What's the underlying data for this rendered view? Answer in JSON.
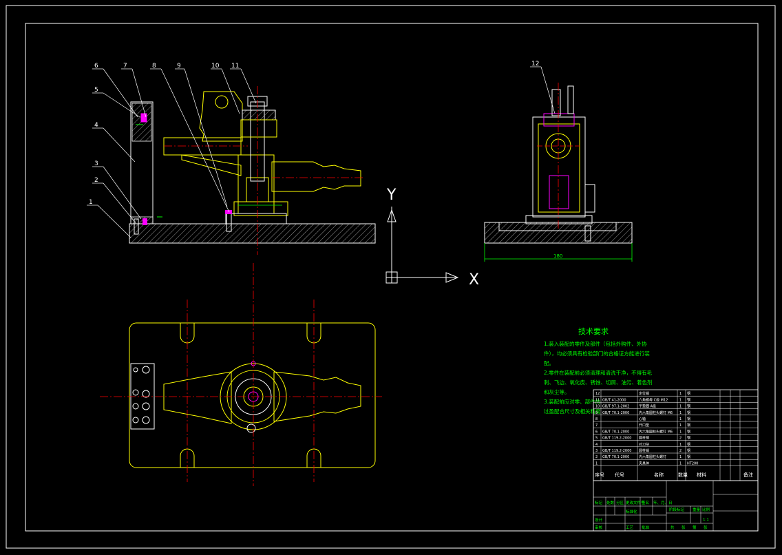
{
  "drawing": {
    "colors": {
      "background": "#000000",
      "frame": "#ffffff",
      "part_outline": "#ffff00",
      "center_line": "#ff0000",
      "hatch": "#cccccc",
      "dimension": "#00ff00",
      "highlight": "#ff00ff",
      "label_text": "#ffffff",
      "notes_text": "#00ff00"
    },
    "balloons": [
      "6",
      "7",
      "8",
      "9",
      "10",
      "11",
      "5",
      "4",
      "3",
      "2",
      "1",
      "12"
    ],
    "ucs": {
      "y_label": "Y",
      "x_label": "X"
    },
    "technical_requirements": {
      "title": "技术要求",
      "lines": [
        "1.装入装配的零件及部件（包括外购件、外协",
        "件），均必须具有检验部门的合格证方能进行装",
        "配。",
        "2.零件在装配前必须清理和清洗干净，不得有毛",
        "刺、飞边、氧化皮、锈蚀、切屑、油污、着色剂",
        "和灰尘等。",
        "3.装配前应对零、部件的",
        "过盈配合尺寸及相关精度"
      ]
    },
    "bom": {
      "header": {
        "no": "序号",
        "code": "代号",
        "name": "名称",
        "qty": "数量",
        "material": "材料",
        "note": "备注"
      },
      "rows": [
        {
          "no": "12",
          "code": "",
          "name": "定位销",
          "qty": "1",
          "material": "钢"
        },
        {
          "no": "11",
          "code": "GB/T 41-2000",
          "name": "六角螺母 C级 M12",
          "qty": "1",
          "material": "钢"
        },
        {
          "no": "10",
          "code": "GB/T 97.1-2002",
          "name": "平垫圈 A级",
          "qty": "1",
          "material": "钢"
        },
        {
          "no": "9",
          "code": "GB/T 70.1-2000",
          "name": "内六角圆柱头螺钉 M6",
          "qty": "1",
          "material": "钢"
        },
        {
          "no": "8",
          "code": "",
          "name": "心轴",
          "qty": "1",
          "material": "钢"
        },
        {
          "no": "7",
          "code": "",
          "name": "开口垫",
          "qty": "1",
          "material": "钢"
        },
        {
          "no": "6",
          "code": "GB/T 70.1-2000",
          "name": "内六角圆柱头螺钉 M6",
          "qty": "1",
          "material": "钢"
        },
        {
          "no": "5",
          "code": "GB/T 119.2-2000",
          "name": "圆柱销",
          "qty": "2",
          "material": "钢"
        },
        {
          "no": "4",
          "code": "",
          "name": "对刀块",
          "qty": "1",
          "material": "钢"
        },
        {
          "no": "3",
          "code": "GB/T 119.2-2000",
          "name": "圆柱销",
          "qty": "2",
          "material": "钢"
        },
        {
          "no": "2",
          "code": "GB/T 70.1-2000",
          "name": "内六角圆柱头螺钉",
          "qty": "1",
          "material": "钢"
        },
        {
          "no": "1",
          "code": "",
          "name": "夹具体",
          "qty": "1",
          "material": "HT200"
        }
      ]
    },
    "title_block": {
      "cells": [
        "标记",
        "处数",
        "分区",
        "更改文件号",
        "签名",
        "年、月、日",
        "设计",
        "标准化",
        "审核",
        "工艺",
        "批准",
        "阶段标记",
        "重量",
        "比例",
        "1:1"
      ],
      "footer": [
        "共",
        "张",
        "第",
        "张"
      ]
    },
    "dimensions": {
      "base_width": "180"
    }
  }
}
